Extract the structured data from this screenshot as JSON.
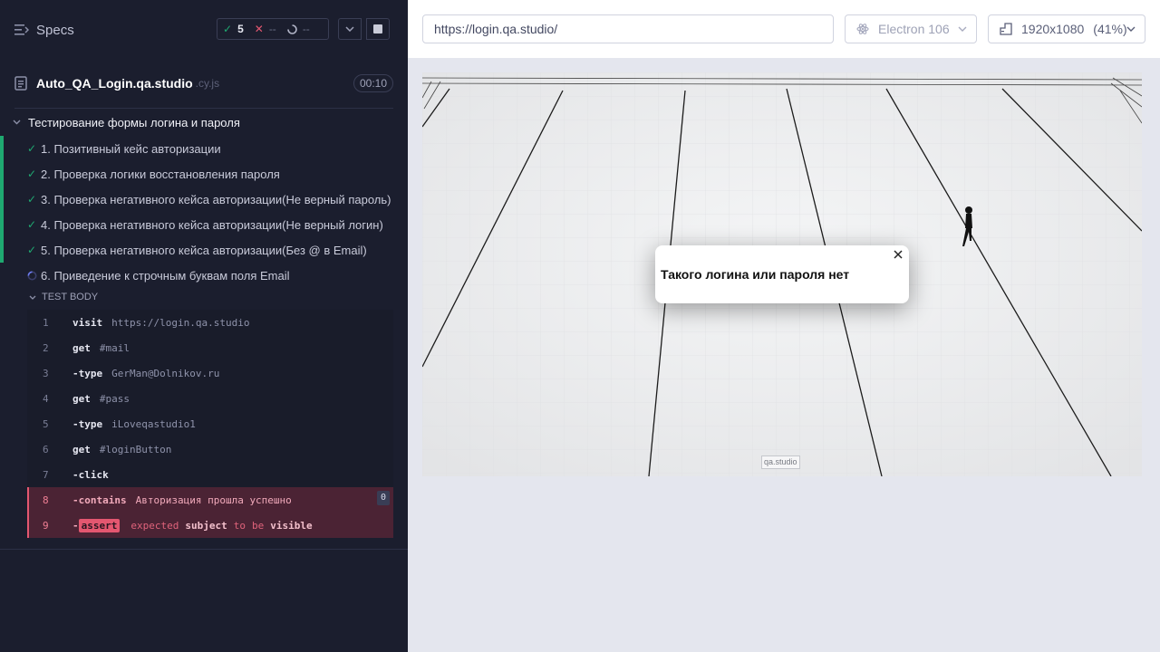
{
  "header": {
    "specs_label": "Specs",
    "passed_count": "5",
    "failed_count": "--",
    "pending_count": "--"
  },
  "spec": {
    "name": "Auto_QA_Login.qa.studio",
    "ext": ".cy.js",
    "duration": "00:10"
  },
  "suite": {
    "title": "Тестирование формы логина и пароля"
  },
  "tests": [
    {
      "label": "1. Позитивный кейс авторизации",
      "status": "passed"
    },
    {
      "label": "2. Проверка логики восстановления пароля",
      "status": "passed"
    },
    {
      "label": "3. Проверка негативного кейса авторизации(Не верный пароль)",
      "status": "passed"
    },
    {
      "label": "4. Проверка негативного кейса авторизации(Не верный логин)",
      "status": "passed"
    },
    {
      "label": "5. Проверка негативного кейса авторизации(Без @ в Email)",
      "status": "passed"
    },
    {
      "label": "6. Приведение к строчным буквам поля Email",
      "status": "running"
    }
  ],
  "test_body_label": "TEST BODY",
  "commands": [
    {
      "num": "1",
      "name": "visit",
      "arg": "https://login.qa.studio"
    },
    {
      "num": "2",
      "name": "get",
      "arg": "#mail"
    },
    {
      "num": "3",
      "name": "-type",
      "arg": "GerMan@Dolnikov.ru"
    },
    {
      "num": "4",
      "name": "get",
      "arg": "#pass"
    },
    {
      "num": "5",
      "name": "-type",
      "arg": "iLoveqastudio1"
    },
    {
      "num": "6",
      "name": "get",
      "arg": "#loginButton"
    },
    {
      "num": "7",
      "name": "-click",
      "arg": ""
    },
    {
      "num": "8",
      "name": "-contains",
      "arg": "Авторизация прошла успешно",
      "badge": "0"
    },
    {
      "num": "9",
      "name": "-",
      "tag": "assert",
      "w1": "expected",
      "w2": "subject",
      "w3": "to",
      "w4": "be",
      "w5": "visible"
    }
  ],
  "aut": {
    "url": "https://login.qa.studio/",
    "browser": "Electron 106",
    "viewport": "1920x1080",
    "scale": "(41%)",
    "modal_text": "Такого логина или пароля нет",
    "watermark": "qa.studio"
  },
  "colors": {
    "pass": "#1fa971",
    "fail": "#e45770",
    "panel": "#1b1e2e"
  }
}
